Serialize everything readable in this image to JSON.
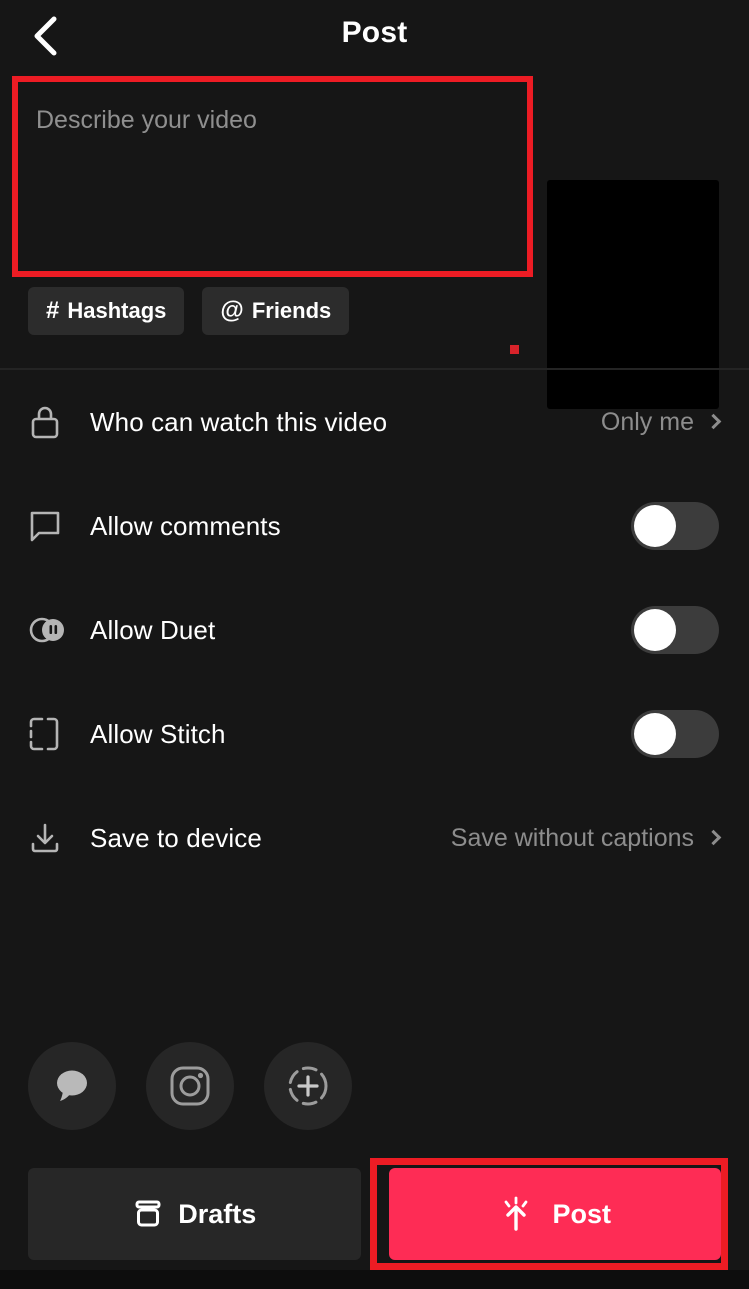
{
  "header": {
    "title": "Post",
    "back_icon": "chevron-left-icon"
  },
  "caption": {
    "placeholder": "Describe your video",
    "value": ""
  },
  "chips": [
    {
      "glyph": "#",
      "label": "Hashtags",
      "icon": "hashtag-icon",
      "name": "hashtags-chip"
    },
    {
      "glyph": "@",
      "label": "Friends",
      "icon": "at-mention-icon",
      "name": "friends-chip"
    }
  ],
  "thumbnail": {
    "alt": "video-thumbnail",
    "color": "#000000"
  },
  "settings": [
    {
      "name": "who-can-watch-row",
      "icon": "lock-icon",
      "label": "Who can watch this video",
      "control": "value",
      "value": "Only me"
    },
    {
      "name": "allow-comments-row",
      "icon": "comment-bubble-icon",
      "label": "Allow comments",
      "control": "toggle",
      "state": "off"
    },
    {
      "name": "allow-duet-row",
      "icon": "duet-icon",
      "label": "Allow Duet",
      "control": "toggle",
      "state": "off"
    },
    {
      "name": "allow-stitch-row",
      "icon": "stitch-icon",
      "label": "Allow Stitch",
      "control": "toggle",
      "state": "off"
    },
    {
      "name": "save-to-device-row",
      "icon": "download-icon",
      "label": "Save to device",
      "control": "value",
      "value": "Save without captions"
    }
  ],
  "share": [
    {
      "name": "share-messages-button",
      "icon": "chat-bubble-icon"
    },
    {
      "name": "share-instagram-button",
      "icon": "instagram-icon"
    },
    {
      "name": "share-instagram-story-button",
      "icon": "instagram-story-icon"
    }
  ],
  "bottom": {
    "drafts_label": "Drafts",
    "drafts_icon": "archive-box-icon",
    "post_label": "Post",
    "post_icon": "post-arrow-sparkle-icon"
  },
  "colors": {
    "background": "#161616",
    "accent_pink": "#FE2C55",
    "annotation_red": "#ED1C24",
    "chip_bg": "#2C2C2C",
    "toggle_track": "#3C3C3C",
    "muted_text": "#8D8D8D"
  }
}
